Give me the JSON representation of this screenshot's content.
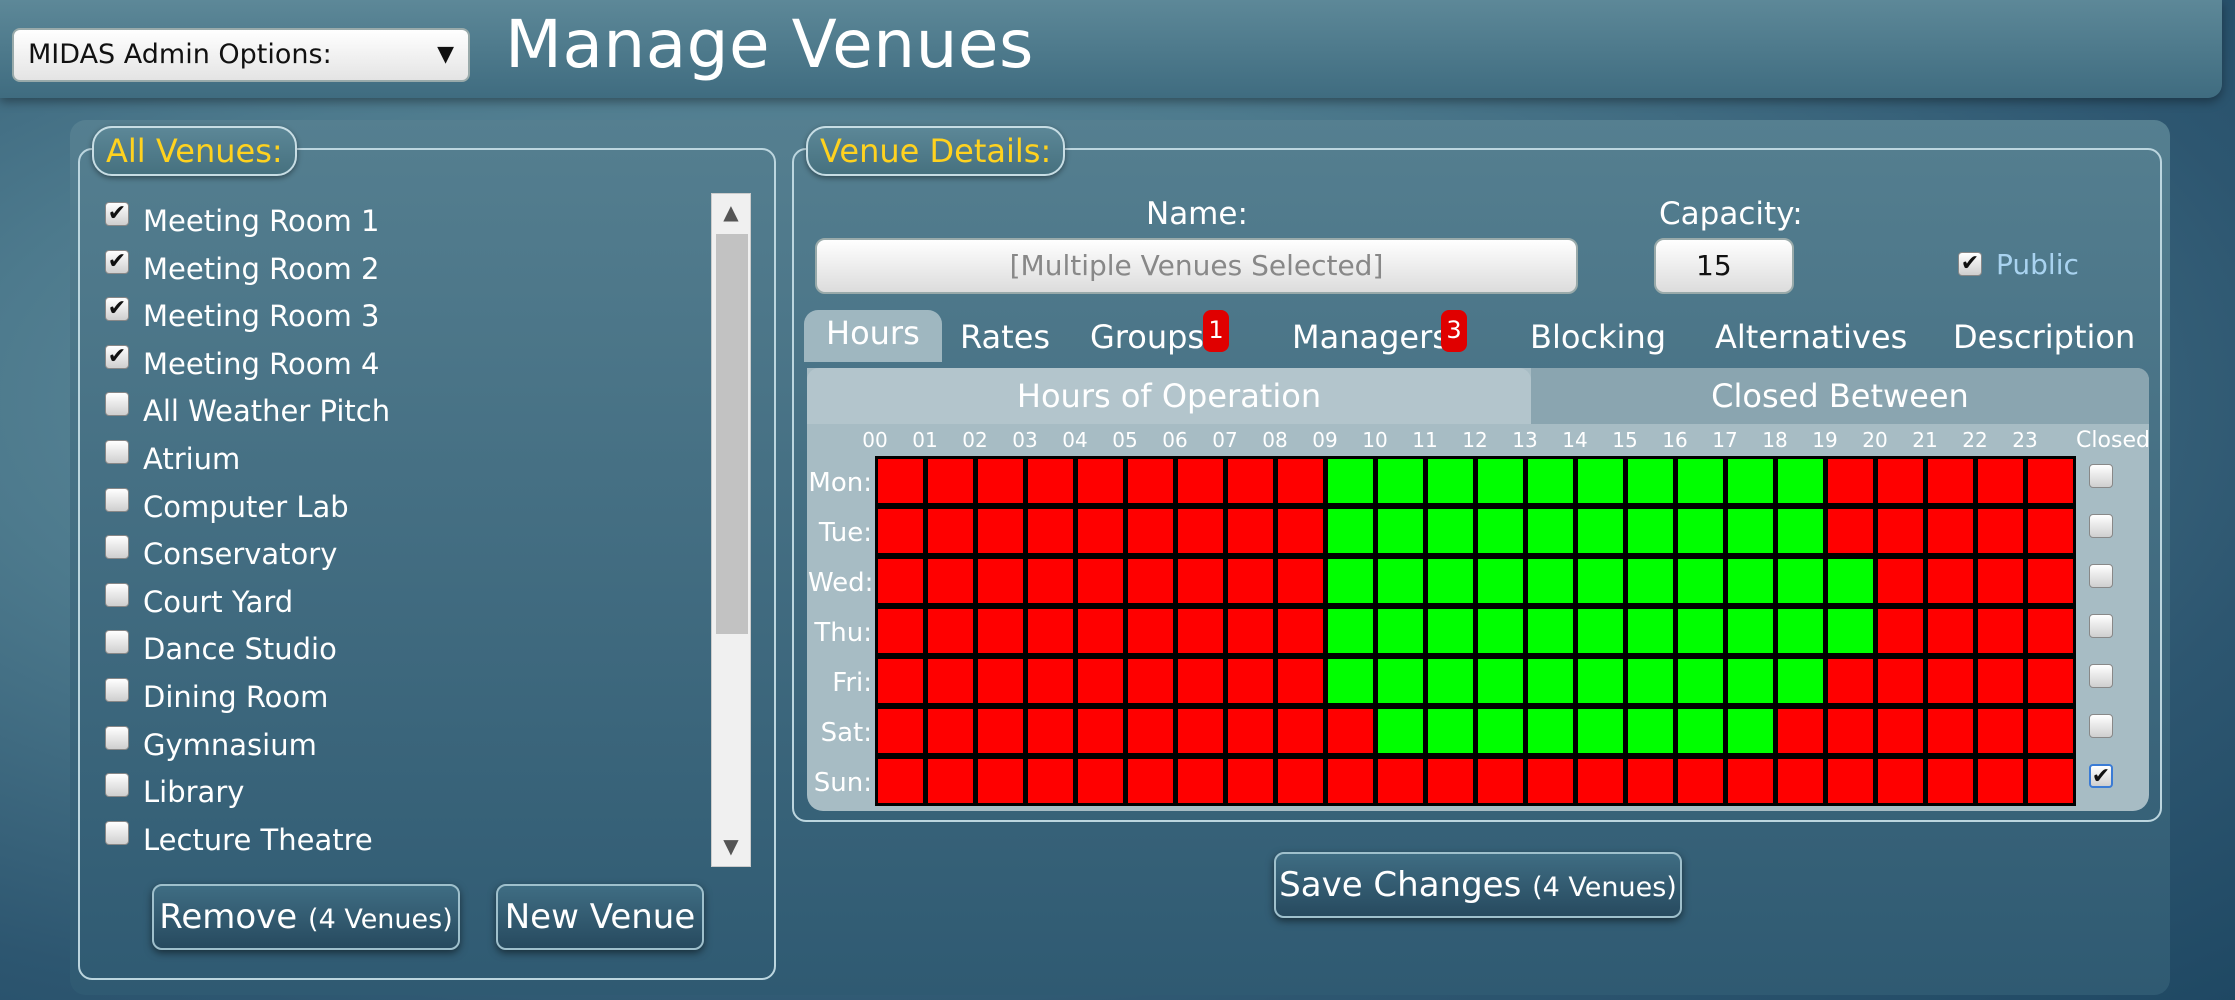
{
  "header": {
    "admin_dropdown": "MIDAS Admin Options:",
    "dropdown_arrow": "▼",
    "title": "Manage Venues"
  },
  "venues_panel": {
    "legend": "All Venues:",
    "items": [
      {
        "label": "Meeting Room 1",
        "checked": true
      },
      {
        "label": "Meeting Room 2",
        "checked": true
      },
      {
        "label": "Meeting Room 3",
        "checked": true
      },
      {
        "label": "Meeting Room 4",
        "checked": true
      },
      {
        "label": "All Weather Pitch",
        "checked": false
      },
      {
        "label": "Atrium",
        "checked": false
      },
      {
        "label": "Computer Lab",
        "checked": false
      },
      {
        "label": "Conservatory",
        "checked": false
      },
      {
        "label": "Court Yard",
        "checked": false
      },
      {
        "label": "Dance Studio",
        "checked": false
      },
      {
        "label": "Dining Room",
        "checked": false
      },
      {
        "label": "Gymnasium",
        "checked": false
      },
      {
        "label": "Library",
        "checked": false
      },
      {
        "label": "Lecture Theatre",
        "checked": false
      }
    ],
    "remove_label": "Remove",
    "remove_count": "(4 Venues)",
    "new_label": "New Venue"
  },
  "details_panel": {
    "legend": "Venue Details:",
    "name_label": "Name:",
    "name_value": "[Multiple Venues Selected]",
    "capacity_label": "Capacity:",
    "capacity_value": "15",
    "public_label": "Public",
    "public_checked": true,
    "tabs": [
      {
        "label": "Hours",
        "active": true
      },
      {
        "label": "Rates"
      },
      {
        "label": "Groups",
        "badge": "1"
      },
      {
        "label": "Managers",
        "badge": "3"
      },
      {
        "label": "Blocking"
      },
      {
        "label": "Alternatives"
      },
      {
        "label": "Description"
      }
    ],
    "subtabs": {
      "hours_of_operation": "Hours of Operation",
      "closed_between": "Closed Between"
    },
    "hours": [
      "00",
      "01",
      "02",
      "03",
      "04",
      "05",
      "06",
      "07",
      "08",
      "09",
      "10",
      "11",
      "12",
      "13",
      "14",
      "15",
      "16",
      "17",
      "18",
      "19",
      "20",
      "21",
      "22",
      "23"
    ],
    "closed_header": "Closed",
    "days": [
      {
        "label": "Mon:",
        "open": [
          9,
          10,
          11,
          12,
          13,
          14,
          15,
          16,
          17,
          18
        ],
        "closed": false
      },
      {
        "label": "Tue:",
        "open": [
          9,
          10,
          11,
          12,
          13,
          14,
          15,
          16,
          17,
          18
        ],
        "closed": false
      },
      {
        "label": "Wed:",
        "open": [
          9,
          10,
          11,
          12,
          13,
          14,
          15,
          16,
          17,
          18,
          19
        ],
        "closed": false
      },
      {
        "label": "Thu:",
        "open": [
          9,
          10,
          11,
          12,
          13,
          14,
          15,
          16,
          17,
          18,
          19
        ],
        "closed": false
      },
      {
        "label": "Fri:",
        "open": [
          9,
          10,
          11,
          12,
          13,
          14,
          15,
          16,
          17,
          18
        ],
        "closed": false
      },
      {
        "label": "Sat:",
        "open": [
          10,
          11,
          12,
          13,
          14,
          15,
          16,
          17
        ],
        "closed": false
      },
      {
        "label": "Sun:",
        "open": [],
        "closed": true
      }
    ],
    "colors": {
      "open": "#00ff00",
      "closed": "#ff0000"
    },
    "save_label": "Save Changes",
    "save_count": "(4 Venues)"
  }
}
